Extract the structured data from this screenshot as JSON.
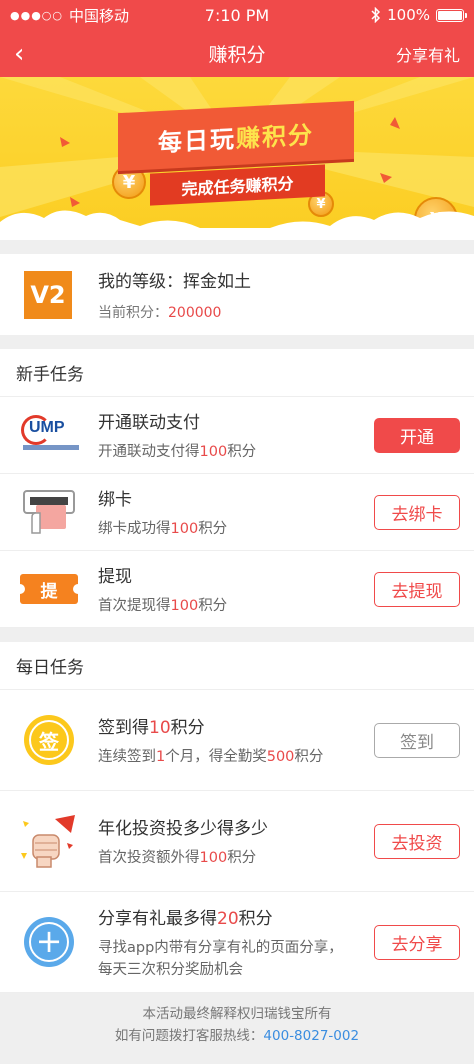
{
  "status_bar": {
    "carrier": "中国移动",
    "time": "7:10 PM",
    "battery": "100%"
  },
  "nav": {
    "back_icon": "‹",
    "title": "赚积分",
    "share": "分享有礼"
  },
  "banner": {
    "headline_pre": "每日玩",
    "headline_em": "赚积分",
    "subline": "完成任务赚积分",
    "coin_symbol": "¥"
  },
  "level": {
    "icon_text": "V2",
    "label": "我的等级：挥金如土",
    "points_label": "当前积分：",
    "points_value": "200000"
  },
  "newbie": {
    "title": "新手任务",
    "items": [
      {
        "name": "开通联动支付",
        "desc_pre": "开通联动支付得",
        "desc_num": "100",
        "desc_post": "积分",
        "button": "开通",
        "icon_label": "UMP"
      },
      {
        "name": "绑卡",
        "desc_pre": "绑卡成功得",
        "desc_num": "100",
        "desc_post": "积分",
        "button": "去绑卡"
      },
      {
        "name": "提现",
        "desc_pre": "首次提现得",
        "desc_num": "100",
        "desc_post": "积分",
        "button": "去提现",
        "icon_label": "提"
      }
    ]
  },
  "daily": {
    "title": "每日任务",
    "items": [
      {
        "name_pre": "签到得",
        "name_num": "10",
        "name_post": "积分",
        "desc_pre": "连续签到",
        "desc_num": "1",
        "desc_mid": "个月，得全勤奖",
        "desc_num2": "500",
        "desc_post": "积分",
        "button": "签到",
        "icon_label": "签"
      },
      {
        "name": "年化投资投多少得多少",
        "desc_pre": "首次投资额外得",
        "desc_num": "100",
        "desc_post": "积分",
        "button": "去投资"
      },
      {
        "name_pre": "分享有礼最多得",
        "name_num": "20",
        "name_post": "积分",
        "desc": "寻找app内带有分享有礼的页面分享，每天三次积分奖励机会",
        "button": "去分享"
      }
    ]
  },
  "footer": {
    "line1": "本活动最终解释权归瑞钱宝所有",
    "line2_pre": "如有问题拨打客服热线：",
    "phone": "400-8027-002"
  },
  "colors": {
    "brand_red": "#f04a4a",
    "banner_yellow": "#fdd93b",
    "link_blue": "#3a8de0"
  }
}
